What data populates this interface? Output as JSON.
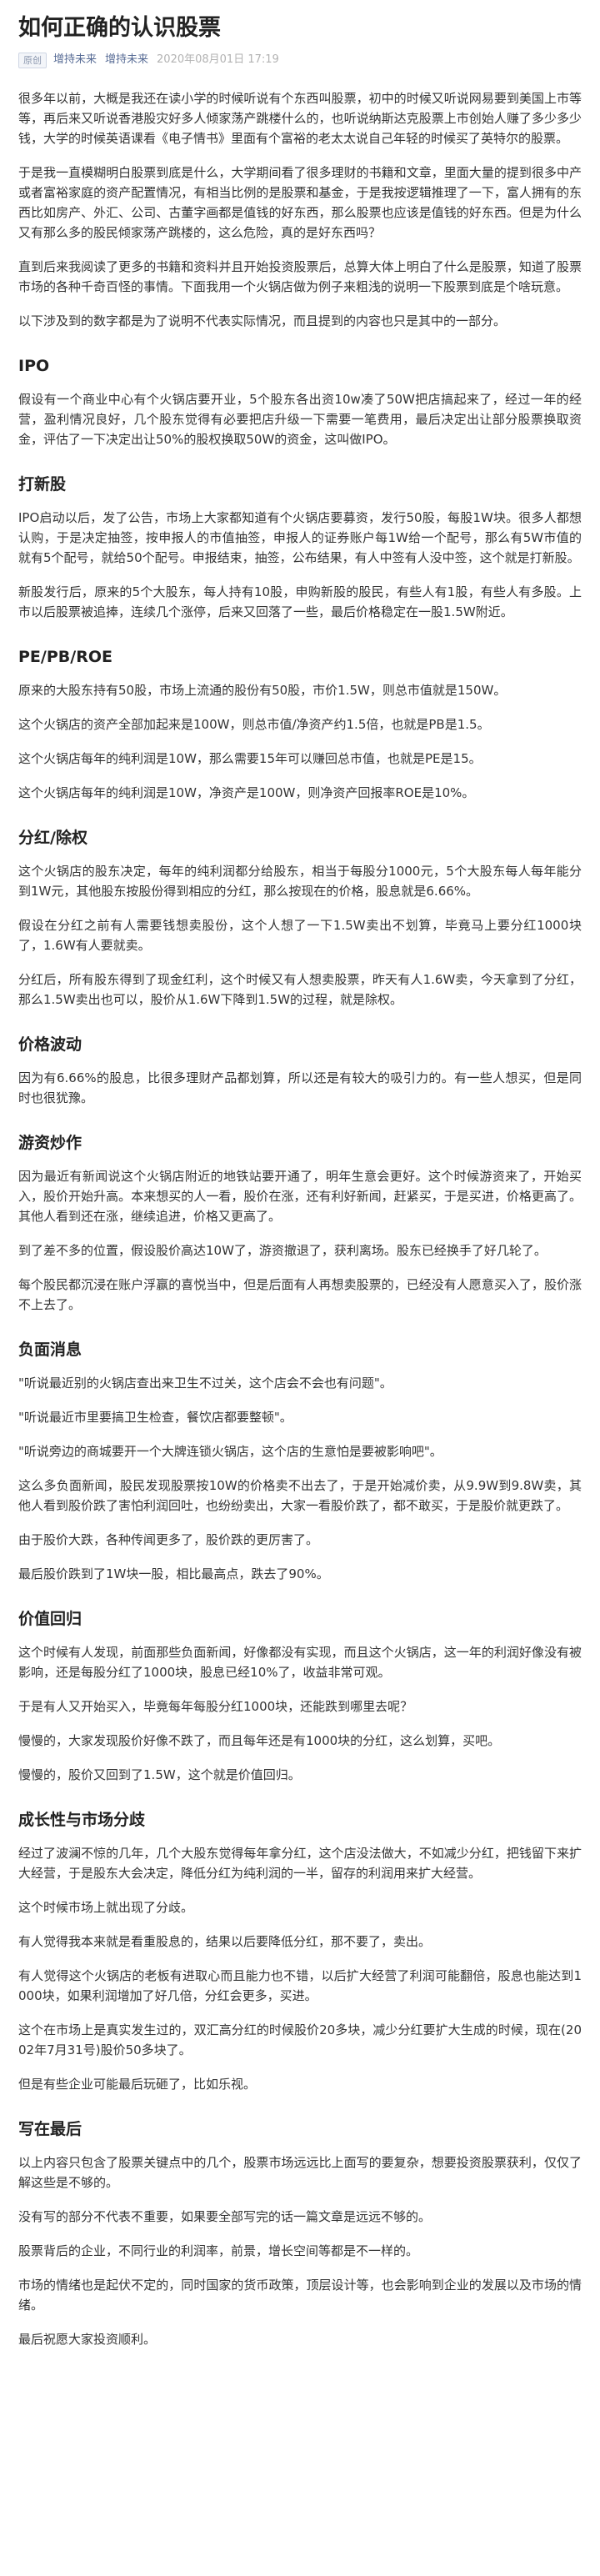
{
  "article": {
    "title": "如何正确的认识股票",
    "badge": "原创",
    "author": "增持未来",
    "account": "增持未来",
    "date": "2020年08月01日 17:19"
  },
  "sections": [
    {
      "heading": "",
      "paragraphs": [
        "很多年以前，大概是我还在读小学的时候听说有个东西叫股票，初中的时候又听说网易要到美国上市等等，再后来又听说香港股灾好多人倾家荡产跳楼什么的，也听说纳斯达克股票上市创始人赚了多少多少钱，大学的时候英语课看《电子情书》里面有个富裕的老太太说自己年轻的时候买了英特尔的股票。",
        "于是我一直模糊明白股票到底是什么，大学期间看了很多理财的书籍和文章，里面大量的提到很多中产或者富裕家庭的资产配置情况，有相当比例的是股票和基金，于是我按逻辑推理了一下，富人拥有的东西比如房产、外汇、公司、古董字画都是值钱的好东西，那么股票也应该是值钱的好东西。但是为什么又有那么多的股民倾家荡产跳楼的，这么危险，真的是好东西吗？",
        "直到后来我阅读了更多的书籍和资料并且开始投资股票后，总算大体上明白了什么是股票，知道了股票市场的各种千奇百怪的事情。下面我用一个火锅店做为例子来粗浅的说明一下股票到底是个啥玩意。",
        "以下涉及到的数字都是为了说明不代表实际情况，而且提到的内容也只是其中的一部分。"
      ]
    },
    {
      "heading": "IPO",
      "paragraphs": [
        "假设有一个商业中心有个火锅店要开业，5个股东各出资10w凑了50W把店搞起来了，经过一年的经营，盈利情况良好，几个股东觉得有必要把店升级一下需要一笔费用，最后决定出让部分股票换取资金，评估了一下决定出让50%的股权换取50W的资金，这叫做IPO。"
      ]
    },
    {
      "heading": "打新股",
      "paragraphs": [
        "IPO启动以后，发了公告，市场上大家都知道有个火锅店要募资，发行50股，每股1W块。很多人都想认购，于是决定抽签，按申报人的市值抽签，申报人的证券账户每1W给一个配号，那么有5W市值的就有5个配号，就给50个配号。申报结束，抽签，公布结果，有人中签有人没中签，这个就是打新股。",
        "新股发行后，原来的5个大股东，每人持有10股，申购新股的股民，有些人有1股，有些人有多股。上市以后股票被追捧，连续几个涨停，后来又回落了一些，最后价格稳定在一股1.5W附近。"
      ]
    },
    {
      "heading": "PE/PB/ROE",
      "paragraphs": [
        "原来的大股东持有50股，市场上流通的股份有50股，市价1.5W，则总市值就是150W。",
        "这个火锅店的资产全部加起来是100W，则总市值/净资产约1.5倍，也就是PB是1.5。",
        "这个火锅店每年的纯利润是10W，那么需要15年可以赚回总市值，也就是PE是15。",
        "这个火锅店每年的纯利润是10W，净资产是100W，则净资产回报率ROE是10%。"
      ]
    },
    {
      "heading": "分红/除权",
      "paragraphs": [
        "这个火锅店的股东决定，每年的纯利润都分给股东，相当于每股分1000元，5个大股东每人每年能分到1W元，其他股东按股份得到相应的分红，那么按现在的价格，股息就是6.66%。",
        "假设在分红之前有人需要钱想卖股份，这个人想了一下1.5W卖出不划算，毕竟马上要分红1000块了，1.6W有人要就卖。",
        "分红后，所有股东得到了现金红利，这个时候又有人想卖股票，昨天有人1.6W卖，今天拿到了分红，那么1.5W卖出也可以，股价从1.6W下降到1.5W的过程，就是除权。"
      ]
    },
    {
      "heading": "价格波动",
      "paragraphs": [
        "因为有6.66%的股息，比很多理财产品都划算，所以还是有较大的吸引力的。有一些人想买，但是同时也很犹豫。"
      ]
    },
    {
      "heading": "游资炒作",
      "paragraphs": [
        "因为最近有新闻说这个火锅店附近的地铁站要开通了，明年生意会更好。这个时候游资来了，开始买入，股价开始升高。本来想买的人一看，股价在涨，还有利好新闻，赶紧买，于是买进，价格更高了。其他人看到还在涨，继续追进，价格又更高了。",
        "到了差不多的位置，假设股价高达10W了，游资撤退了，获利离场。股东已经换手了好几轮了。",
        "每个股民都沉浸在账户浮赢的喜悦当中，但是后面有人再想卖股票的，已经没有人愿意买入了，股价涨不上去了。"
      ]
    },
    {
      "heading": "负面消息",
      "paragraphs": [
        "\"听说最近别的火锅店查出来卫生不过关，这个店会不会也有问题\"。",
        "\"听说最近市里要搞卫生检查，餐饮店都要整顿\"。",
        "\"听说旁边的商城要开一个大牌连锁火锅店，这个店的生意怕是要被影响吧\"。",
        "这么多负面新闻，股民发现股票按10W的价格卖不出去了，于是开始减价卖，从9.9W到9.8W卖，其他人看到股价跌了害怕利润回吐，也纷纷卖出，大家一看股价跌了，都不敢买，于是股价就更跌了。",
        "由于股价大跌，各种传闻更多了，股价跌的更厉害了。",
        "最后股价跌到了1W块一股，相比最高点，跌去了90%。"
      ]
    },
    {
      "heading": "价值回归",
      "paragraphs": [
        "这个时候有人发现，前面那些负面新闻，好像都没有实现，而且这个火锅店，这一年的利润好像没有被影响，还是每股分红了1000块，股息已经10%了，收益非常可观。",
        "于是有人又开始买入，毕竟每年每股分红1000块，还能跌到哪里去呢？",
        "慢慢的，大家发现股价好像不跌了，而且每年还是有1000块的分红，这么划算，买吧。",
        "慢慢的，股价又回到了1.5W，这个就是价值回归。"
      ]
    },
    {
      "heading": "成长性与市场分歧",
      "paragraphs": [
        "经过了波澜不惊的几年，几个大股东觉得每年拿分红，这个店没法做大，不如减少分红，把钱留下来扩大经营，于是股东大会决定，降低分红为纯利润的一半，留存的利润用来扩大经营。",
        "这个时候市场上就出现了分歧。",
        "有人觉得我本来就是看重股息的，结果以后要降低分红，那不要了，卖出。",
        "有人觉得这个火锅店的老板有进取心而且能力也不错，以后扩大经营了利润可能翻倍，股息也能达到1000块，如果利润增加了好几倍，分红会更多，买进。",
        "这个在市场上是真实发生过的，双汇高分红的时候股价20多块，减少分红要扩大生成的时候，现在(2002年7月31号)股价50多块了。",
        "但是有些企业可能最后玩砸了，比如乐视。"
      ]
    },
    {
      "heading": "写在最后",
      "paragraphs": [
        "以上内容只包含了股票关键点中的几个，股票市场远远比上面写的要复杂，想要投资股票获利，仅仅了解这些是不够的。",
        "没有写的部分不代表不重要，如果要全部写完的话一篇文章是远远不够的。",
        "股票背后的企业，不同行业的利润率，前景，增长空间等都是不一样的。",
        "市场的情绪也是起伏不定的，同时国家的货币政策，顶层设计等，也会影响到企业的发展以及市场的情绪。",
        "最后祝愿大家投资顺利。"
      ]
    }
  ]
}
